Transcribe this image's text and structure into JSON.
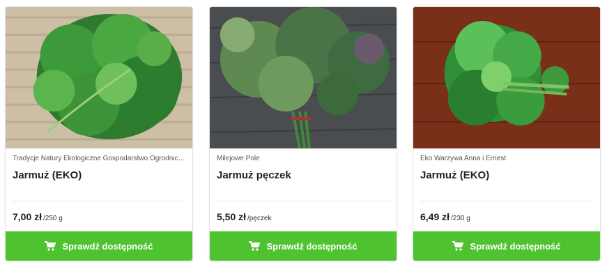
{
  "cards": [
    {
      "producer": "Tradycje Natury Ekologiczne Gospodarstwo Ogrodnicze",
      "title": "Jarmuż (EKO)",
      "price": "7,00 zł",
      "unit": "/250 g",
      "cta": "Sprawdź dostępność",
      "image": "kale-on-wicker-mat"
    },
    {
      "producer": "Milejowe Pole",
      "title": "Jarmuż pęczek",
      "price": "5,50 zł",
      "unit": "/pęczek",
      "cta": "Sprawdź dostępność",
      "image": "kale-bunch-on-wood"
    },
    {
      "producer": "Eko Warzywa Anna i Ernest",
      "title": "Jarmuż (EKO)",
      "price": "6,49 zł",
      "unit": "/230 g",
      "cta": "Sprawdź dostępność",
      "image": "kale-on-dark-wood"
    }
  ],
  "colors": {
    "cta_green": "#4ec32f",
    "text_dark": "#222222",
    "text_muted": "#555555"
  },
  "icons": {
    "cta": "cart-icon"
  }
}
